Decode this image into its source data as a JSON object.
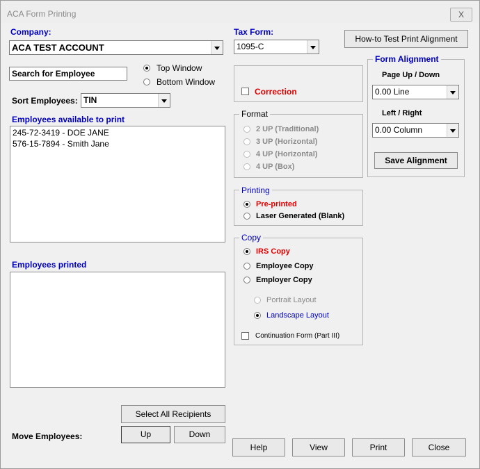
{
  "window": {
    "title": "ACA Form Printing",
    "close_glyph": "X"
  },
  "company": {
    "label": "Company:",
    "value": "ACA TEST ACCOUNT"
  },
  "tax_form": {
    "label": "Tax Form:",
    "value": "1095-C"
  },
  "how_to_button": "How-to Test Print Alignment",
  "search": {
    "value": "Search for Employee"
  },
  "window_choice": {
    "top": "Top Window",
    "bottom": "Bottom Window",
    "selected": "top"
  },
  "sort": {
    "label": "Sort Employees:",
    "value": "TIN"
  },
  "available": {
    "label": "Employees available to print",
    "items": [
      "245-72-3419 - DOE JANE",
      "576-15-7894 - Smith Jane"
    ]
  },
  "printed": {
    "label": "Employees printed",
    "items": []
  },
  "correction": {
    "label": "Correction",
    "checked": false
  },
  "format": {
    "label": "Format",
    "options": [
      "2 UP (Traditional)",
      "3 UP (Horizontal)",
      "4 UP (Horizontal)",
      "4 UP (Box)"
    ]
  },
  "printing": {
    "label": "Printing",
    "options": [
      "Pre-printed",
      "Laser Generated (Blank)"
    ],
    "selected": 0
  },
  "copy": {
    "label": "Copy",
    "options": [
      "IRS Copy",
      "Employee Copy",
      "Employer Copy"
    ],
    "selected": 0,
    "layout_options": [
      "Portrait Layout",
      "Landscape Layout"
    ],
    "layout_selected": 1,
    "continuation_label": "Continuation Form (Part III)",
    "continuation_checked": false
  },
  "alignment": {
    "label": "Form Alignment",
    "page_label": "Page Up / Down",
    "page_value": "0.00 Line",
    "lr_label": "Left / Right",
    "lr_value": "0.00 Column",
    "save_label": "Save  Alignment"
  },
  "move": {
    "select_all": "Select All Recipients",
    "label": "Move Employees:",
    "up": "Up",
    "down": "Down"
  },
  "footer": {
    "help": "Help",
    "view": "View",
    "print": "Print",
    "close": "Close"
  },
  "colors": {
    "label_blue": "#0000c0",
    "highlight_red": "#e00000",
    "background": "#f0f0f0"
  }
}
